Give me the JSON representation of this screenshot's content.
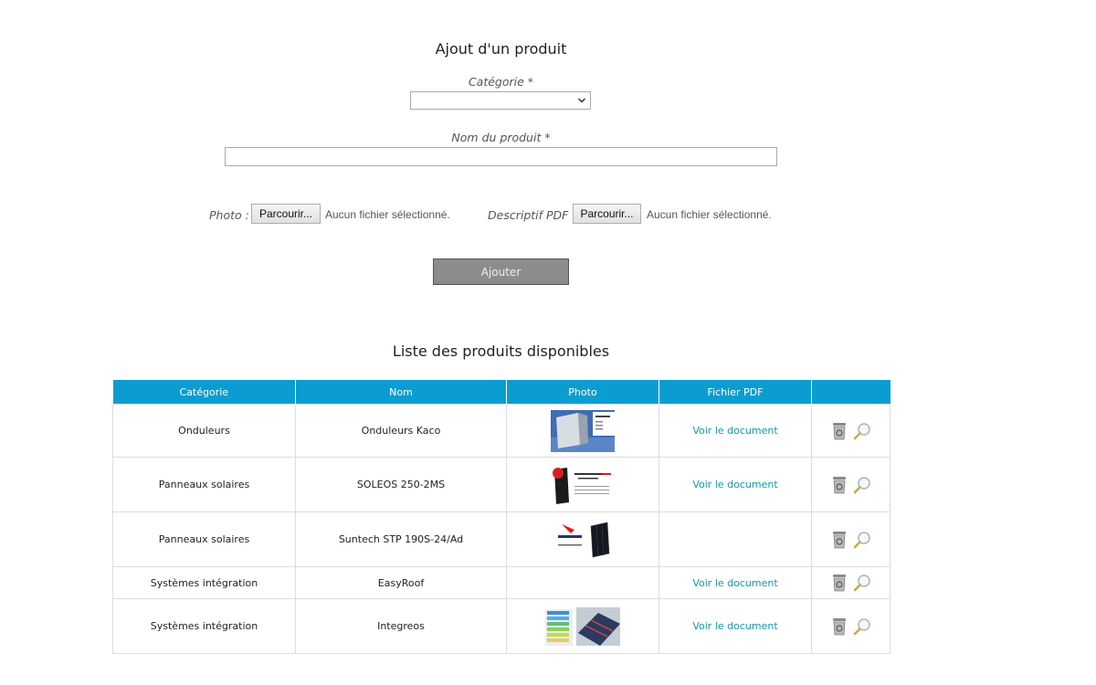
{
  "form": {
    "title": "Ajout d'un produit",
    "category_label": "Catégorie *",
    "category_value": "",
    "name_label": "Nom du produit *",
    "name_value": "",
    "photo_label": "Photo :",
    "photo_browse": "Parcourir...",
    "photo_status": "Aucun fichier sélectionné.",
    "pdf_label": "Descriptif PDF :",
    "pdf_browse": "Parcourir...",
    "pdf_status": "Aucun fichier sélectionné.",
    "submit_label": "Ajouter"
  },
  "list": {
    "title": "Liste des produits disponibles",
    "headers": [
      "Catégorie",
      "Nom",
      "Photo",
      "Fichier PDF",
      ""
    ],
    "link_label": "Voir le document",
    "rows": [
      {
        "category": "Onduleurs",
        "name": "Onduleurs Kaco",
        "photo": "inverter-photo",
        "pdf": "Voir le document"
      },
      {
        "category": "Panneaux solaires",
        "name": "SOLEOS 250-2MS",
        "photo": "soleos-panel-photo",
        "pdf": "Voir le document"
      },
      {
        "category": "Panneaux solaires",
        "name": "Suntech STP 190S-24/Ad",
        "photo": "suntech-panel-photo",
        "pdf": ""
      },
      {
        "category": "Systèmes intégration",
        "name": "EasyRoof",
        "photo": "",
        "pdf": "Voir le document"
      },
      {
        "category": "Systèmes intégration",
        "name": "Integreos",
        "photo": "integreos-photo",
        "pdf": "Voir le document"
      }
    ]
  },
  "colors": {
    "header_bg": "#0b9dd1",
    "link": "#1597a7",
    "button_bg": "#8c8c8c"
  },
  "icons": [
    "trash-icon",
    "magnifier-icon",
    "chevron-down-icon"
  ]
}
